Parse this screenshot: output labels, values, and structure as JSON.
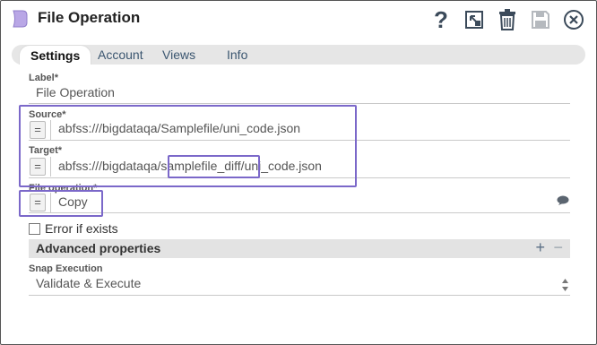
{
  "window": {
    "title": "File Operation",
    "icons": [
      "snap-icon",
      "help-icon",
      "popout-icon",
      "trash-icon",
      "save-icon",
      "close-icon"
    ],
    "help_glyph": "?"
  },
  "tabs": [
    {
      "label": "Settings",
      "active": true
    },
    {
      "label": "Account",
      "active": false
    },
    {
      "label": "Views",
      "active": false
    },
    {
      "label": "Info",
      "active": false
    }
  ],
  "fields": {
    "label": {
      "label": "Label*",
      "value": "File Operation"
    },
    "source": {
      "label": "Source*",
      "value": "abfss:///bigdataqa/Samplefile/uni_code.json"
    },
    "target": {
      "label": "Target*",
      "prefix": "abfss:///bigdataqa/",
      "highlight": "samplefile_diff/",
      "suffix": "uni_code.json"
    },
    "file_operation": {
      "label": "File operation*",
      "value": "Copy"
    },
    "expression_glyph": "="
  },
  "error_if_exists": {
    "label": "Error if exists",
    "checked": false
  },
  "advanced": {
    "title": "Advanced properties",
    "plus": "+",
    "minus": "−"
  },
  "snap_execution": {
    "label": "Snap Execution",
    "value": "Validate & Execute"
  },
  "colors": {
    "highlight": "#7b68c9",
    "snap_icon": "#b9a7e6",
    "tab_bar": "#e6e6e6",
    "adv_bar": "#e3e3e3"
  }
}
